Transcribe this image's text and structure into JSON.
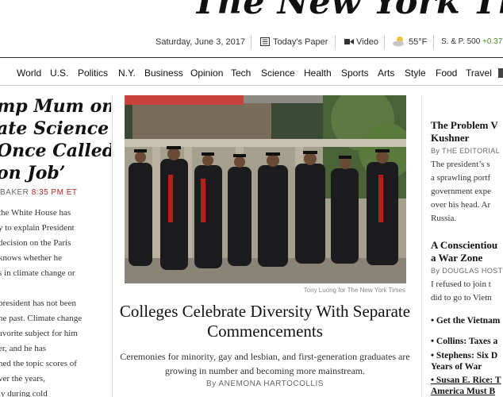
{
  "masthead": {
    "logo": "The New York Times"
  },
  "infobar": {
    "date": "Saturday, June 3, 2017",
    "todays_paper": "Today's Paper",
    "video": "Video",
    "weather": "55°F",
    "market_label": "S. & P. 500",
    "market_change": "+0.37"
  },
  "nav": [
    "World",
    "U.S.",
    "Politics",
    "N.Y.",
    "Business",
    "Opinion",
    "Tech",
    "Science",
    "Health",
    "Sports",
    "Arts",
    "Style",
    "Food",
    "Travel"
  ],
  "left_story": {
    "headline_lines": [
      "mp Mum on",
      "ate Science",
      "Once Called",
      "on Job’"
    ],
    "byline": "BAKER",
    "time": "8:35 PM ET",
    "summary_lines": [
      "the White House has",
      "y to explain President",
      "decision on the Paris",
      "knows whether he",
      "s in climate change or",
      "",
      "president has not been",
      "he past. Climate change",
      "avorite subject for him",
      "er, and he has",
      "ned the topic scores of",
      "ver the years,",
      "ly during cold"
    ]
  },
  "center_story": {
    "photo_credit": "Tony Luong for The New York Times",
    "headline": "Colleges Celebrate Diversity With Separate Commencements",
    "summary": "Ceremonies for minority, gay and lesbian, and first-generation graduates are growing in number and becoming more mainstream.",
    "byline": "By ANEMONA HARTOCOLLIS"
  },
  "right_column": {
    "op1": {
      "headline_lines": [
        "The Problem V",
        "Kushner"
      ],
      "byline": "By THE EDITORIAL",
      "summary_lines": [
        "The president’s s",
        "a sprawling portf",
        "government expe",
        "over his head. Ar",
        "Russia."
      ]
    },
    "op2": {
      "headline_lines": [
        "A Conscientiou",
        "a War Zone"
      ],
      "byline": "By DOUGLAS HOST",
      "summary_lines": [
        "I refused to join t",
        "did to go to Vietn"
      ]
    },
    "links": [
      {
        "lines": [
          "• Get the Vietnam"
        ]
      },
      {
        "lines": [
          "• Collins: Taxes a"
        ]
      },
      {
        "lines": [
          "• Stephens: Six D",
          "  Years of War"
        ]
      },
      {
        "lines": [
          "• Susan E. Rice: T",
          "  America Must B"
        ]
      }
    ]
  }
}
